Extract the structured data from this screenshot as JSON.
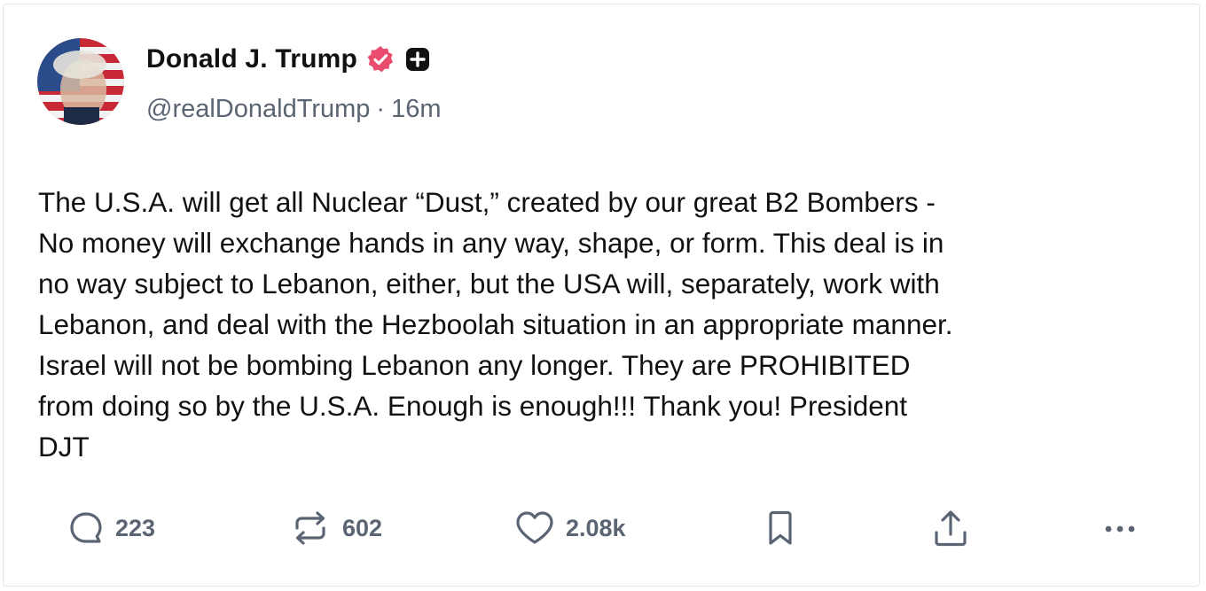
{
  "post": {
    "author": {
      "display_name": "Donald J. Trump",
      "handle": "@realDonaldTrump",
      "verified_badge_color": "#ea4c6d",
      "extra_badge_icon": "plus-box-icon"
    },
    "meta_separator": "·",
    "timestamp": "16m",
    "body": "The U.S.A. will get all Nuclear “Dust,” created by our great B2 Bombers -\nNo money will exchange hands in any way, shape, or form. This deal is in\nno way subject to Lebanon, either, but the USA will, separately, work with\nLebanon, and deal with the Hezboolah situation in an appropriate manner.\nIsrael will not be bombing Lebanon any longer. They are PROHIBITED\nfrom doing so by the U.S.A. Enough is enough!!! Thank you! President\nDJT",
    "actions": {
      "replies": {
        "icon": "reply-bubble-icon",
        "count": "223"
      },
      "retruths": {
        "icon": "repost-arrows-icon",
        "count": "602"
      },
      "likes": {
        "icon": "heart-icon",
        "count": "2.08k"
      },
      "bookmark": {
        "icon": "bookmark-icon"
      },
      "share": {
        "icon": "share-upload-icon"
      },
      "more": {
        "icon": "more-dots-icon"
      }
    }
  },
  "colors": {
    "text_primary": "#111111",
    "text_secondary": "#5b6473",
    "card_border": "#e6e6e6"
  }
}
